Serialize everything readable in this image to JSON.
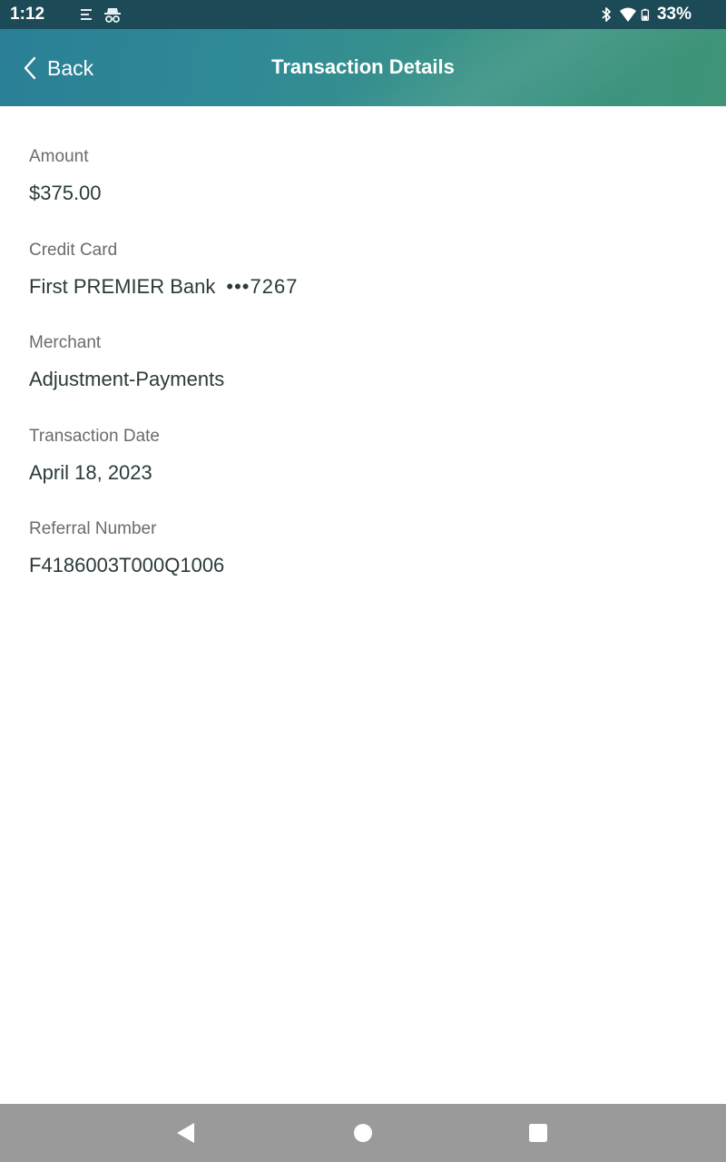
{
  "status_bar": {
    "time": "1:12",
    "battery_percent": "33%",
    "icons": [
      "notes-icon",
      "incognito-icon",
      "bluetooth-icon",
      "wifi-icon",
      "battery-icon"
    ]
  },
  "header": {
    "back_label": "Back",
    "title": "Transaction Details"
  },
  "details": {
    "amount": {
      "label": "Amount",
      "value": "$375.00"
    },
    "credit_card": {
      "label": "Credit Card",
      "bank": "First PREMIER Bank",
      "masked": "•••7267"
    },
    "merchant": {
      "label": "Merchant",
      "value": "Adjustment-Payments"
    },
    "transaction_date": {
      "label": "Transaction Date",
      "value": "April 18, 2023"
    },
    "referral_number": {
      "label": "Referral Number",
      "value": "F4186003T000Q1006"
    }
  },
  "nav_bar": {
    "buttons": [
      "nav-back-icon",
      "nav-home-icon",
      "nav-recents-icon"
    ]
  },
  "colors": {
    "status_bar": "#1c4a57",
    "header_start": "#2a7f96",
    "header_end": "#3f9478",
    "label_text": "#6b6b6b",
    "value_text": "#2b3a3a",
    "nav_bar": "#9a9a9a"
  }
}
